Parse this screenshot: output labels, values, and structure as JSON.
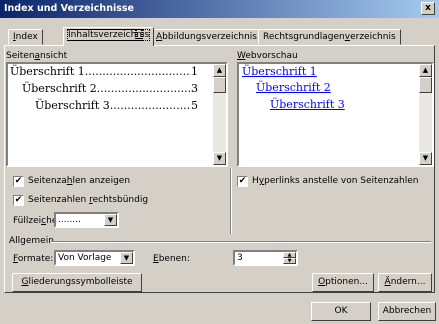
{
  "window": {
    "title": "Index und Verzeichnisse",
    "close": "x"
  },
  "tabs": [
    {
      "label": "Index",
      "u": "I",
      "rest": "ndex"
    },
    {
      "label": "Inhaltsverzeichnis",
      "pre": "Inhaltsverzeich",
      "u": "n",
      "rest": "is"
    },
    {
      "label": "Abbildungsverzeichnis",
      "u": "A",
      "rest": "bbildungsverzeichnis"
    },
    {
      "label": "Rechtsgrundlagenverzeichnis",
      "pre": "Rechtsgrundlagen",
      "u": "v",
      "rest": "erzeichnis"
    }
  ],
  "print_preview": {
    "label_pre": "Seiten",
    "label_u": "a",
    "label_rest": "nsicht",
    "entries": [
      {
        "text": "Überschrift 1",
        "page": "1"
      },
      {
        "text": "Überschrift 2",
        "page": "3"
      },
      {
        "text": "Überschrift 3",
        "page": "5"
      }
    ]
  },
  "web_preview": {
    "label_u": "W",
    "label_rest": "ebvorschau",
    "entries": [
      "Überschrift 1",
      "Überschrift 2",
      "Überschrift 3"
    ]
  },
  "options": {
    "show_page_numbers": {
      "pre": "Seitenza",
      "u": "h",
      "rest": "len anzeigen",
      "checked": true
    },
    "right_align": {
      "pre": "Seitenzahlen ",
      "u": "r",
      "rest": "echtsbündig",
      "checked": true
    },
    "hyperlinks": {
      "pre": "H",
      "u": "y",
      "rest": "perlinks anstelle von Seitenzahlen",
      "checked": true
    },
    "fill_label_pre": "Füllzei",
    "fill_label_u": "c",
    "fill_label_rest": "hen:",
    "fill_value": "........"
  },
  "general": {
    "title": "Allgemein",
    "formats_u": "F",
    "formats_rest": "ormate:",
    "formats_value": "Von Vorlage",
    "levels_u": "E",
    "levels_rest": "benen:",
    "levels_value": "3"
  },
  "buttons": {
    "outline_u": "G",
    "outline_rest": "liederungssymbolleiste",
    "options_u": "O",
    "options_rest": "ptionen...",
    "modify_u": "Ä",
    "modify_rest": "ndern...",
    "ok": "OK",
    "cancel": "Abbrechen"
  },
  "glyphs": {
    "check": "✔",
    "down": "▼",
    "up": "▲"
  }
}
